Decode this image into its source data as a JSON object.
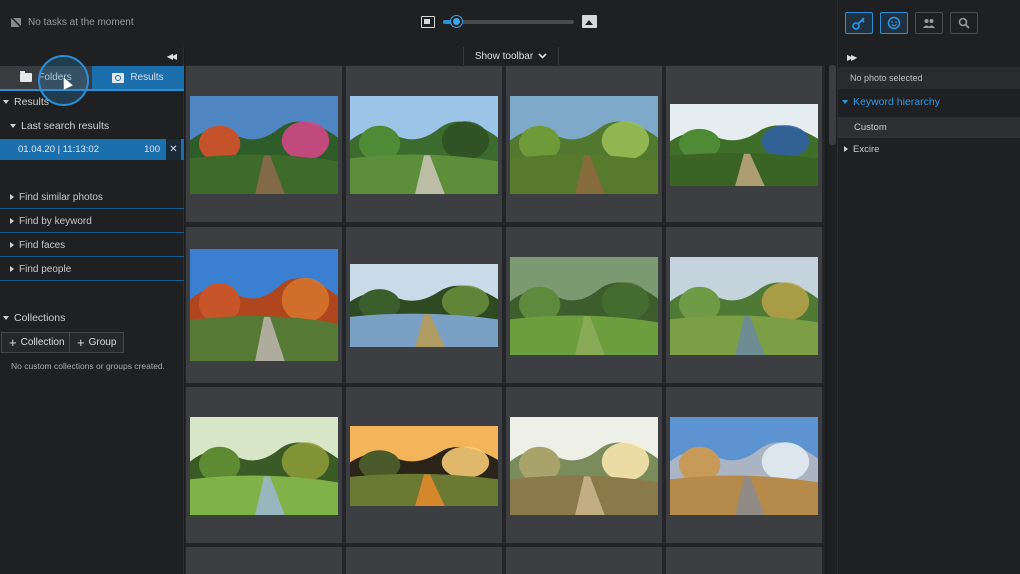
{
  "topbar": {
    "task_status": "No tasks at the moment",
    "zoom_level": 0.1
  },
  "center": {
    "show_toolbar_label": "Show toolbar"
  },
  "left_panel": {
    "tabs": [
      {
        "label": "Folders",
        "icon": "folder-icon"
      },
      {
        "label": "Results",
        "icon": "results-icon"
      }
    ],
    "results_heading": "Results",
    "last_search_heading": "Last search results",
    "search_result": {
      "label": "01.04.20 | 11:13:02",
      "count": "100"
    },
    "find_items": [
      {
        "label": "Find similar photos"
      },
      {
        "label": "Find by keyword"
      },
      {
        "label": "Find faces"
      },
      {
        "label": "Find people"
      }
    ],
    "collections_heading": "Collections",
    "collection_button": "Collection",
    "group_button": "Group",
    "no_collections_text": "No custom collections or groups created."
  },
  "right_panel": {
    "toolbar_icons": [
      "keyword-icon",
      "face-icon",
      "people-icon",
      "search-icon"
    ],
    "no_photo_text": "No photo selected",
    "keyword_hierarchy_label": "Keyword hierarchy",
    "keywords": [
      {
        "label": "Custom"
      },
      {
        "label": "Excire"
      }
    ]
  },
  "colors": {
    "accent": "#2b8fd6",
    "panel_bg": "#1f2022",
    "grid_bg": "#242528",
    "cell_bg": "#3d3e41"
  },
  "photos": [
    "autumn-garden-path-flowers",
    "tree-lined-gravel-avenue",
    "dirt-path-through-meadow",
    "hobbit-hole-round-door",
    "red-autumn-trees-park",
    "trees-reflected-in-river",
    "green-lawn-garden",
    "stream-through-meadow",
    "river-bank-willow-tree",
    "sunset-tree-fields",
    "sunlit-rural-road",
    "mountain-path-fields"
  ]
}
